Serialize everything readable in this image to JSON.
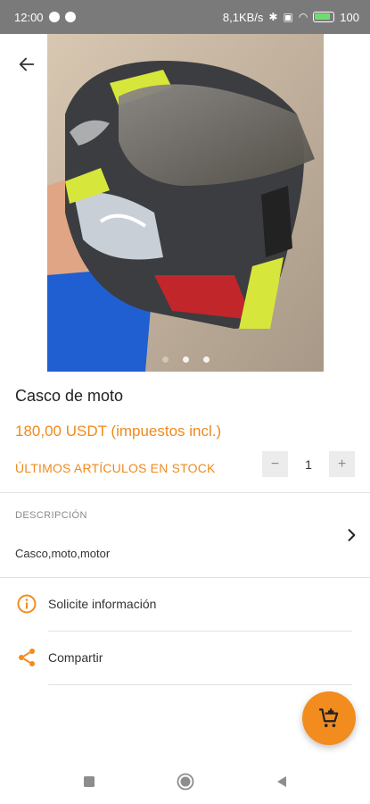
{
  "status_bar": {
    "time": "12:00",
    "network_speed": "8,1KB/s",
    "battery": "100"
  },
  "gallery": {
    "image_icon": "motorcycle-helmet-photo",
    "dots": 3,
    "active_dot": 0
  },
  "product": {
    "title": "Casco de moto",
    "price": "180,00 USDT (impuestos incl.)",
    "stock_status": "ÚLTIMOS ARTÍCULOS EN STOCK",
    "quantity": {
      "minus_label": "−",
      "value": "1",
      "plus_label": "+"
    }
  },
  "description": {
    "heading": "DESCRIPCIÓN",
    "text": "Casco,moto,motor"
  },
  "actions": [
    {
      "label": "Solicite información",
      "icon": "info-icon"
    },
    {
      "label": "Compartir",
      "icon": "share-icon"
    }
  ],
  "fab": {
    "icon": "add-to-cart-icon"
  },
  "colors": {
    "accent": "#f28c1e",
    "status_bar": "#7a7a7a"
  }
}
